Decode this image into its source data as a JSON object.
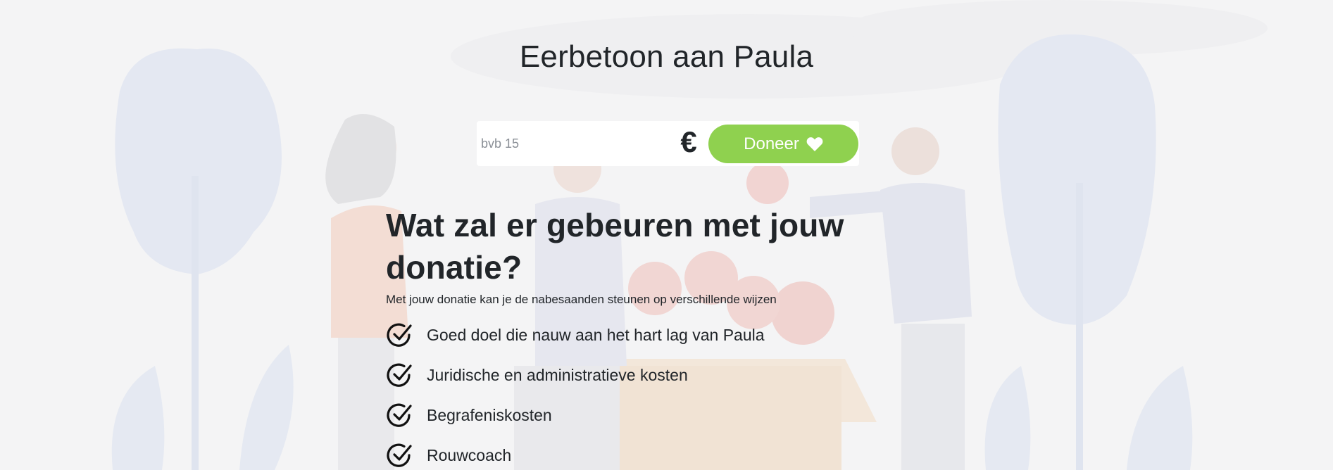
{
  "page": {
    "title": "Eerbetoon aan Paula"
  },
  "donation_form": {
    "amount_placeholder": "bvb 15",
    "amount_value": "",
    "currency_symbol": "€",
    "donate_label": "Doneer",
    "donate_icon": "heart-icon",
    "button_color": "#8fd14f"
  },
  "info": {
    "title": "Wat zal er gebeuren met jouw donatie?",
    "subtitle": "Met jouw donatie kan je de nabesaanden steunen op verschillende wijzen",
    "items": [
      {
        "label": "Goed doel die nauw aan het hart lag van Paula",
        "icon": "check-circle-icon"
      },
      {
        "label": "Juridische en administratieve kosten",
        "icon": "check-circle-icon"
      },
      {
        "label": "Begrafeniskosten",
        "icon": "check-circle-icon"
      },
      {
        "label": "Rouwcoach",
        "icon": "check-circle-icon"
      }
    ]
  }
}
